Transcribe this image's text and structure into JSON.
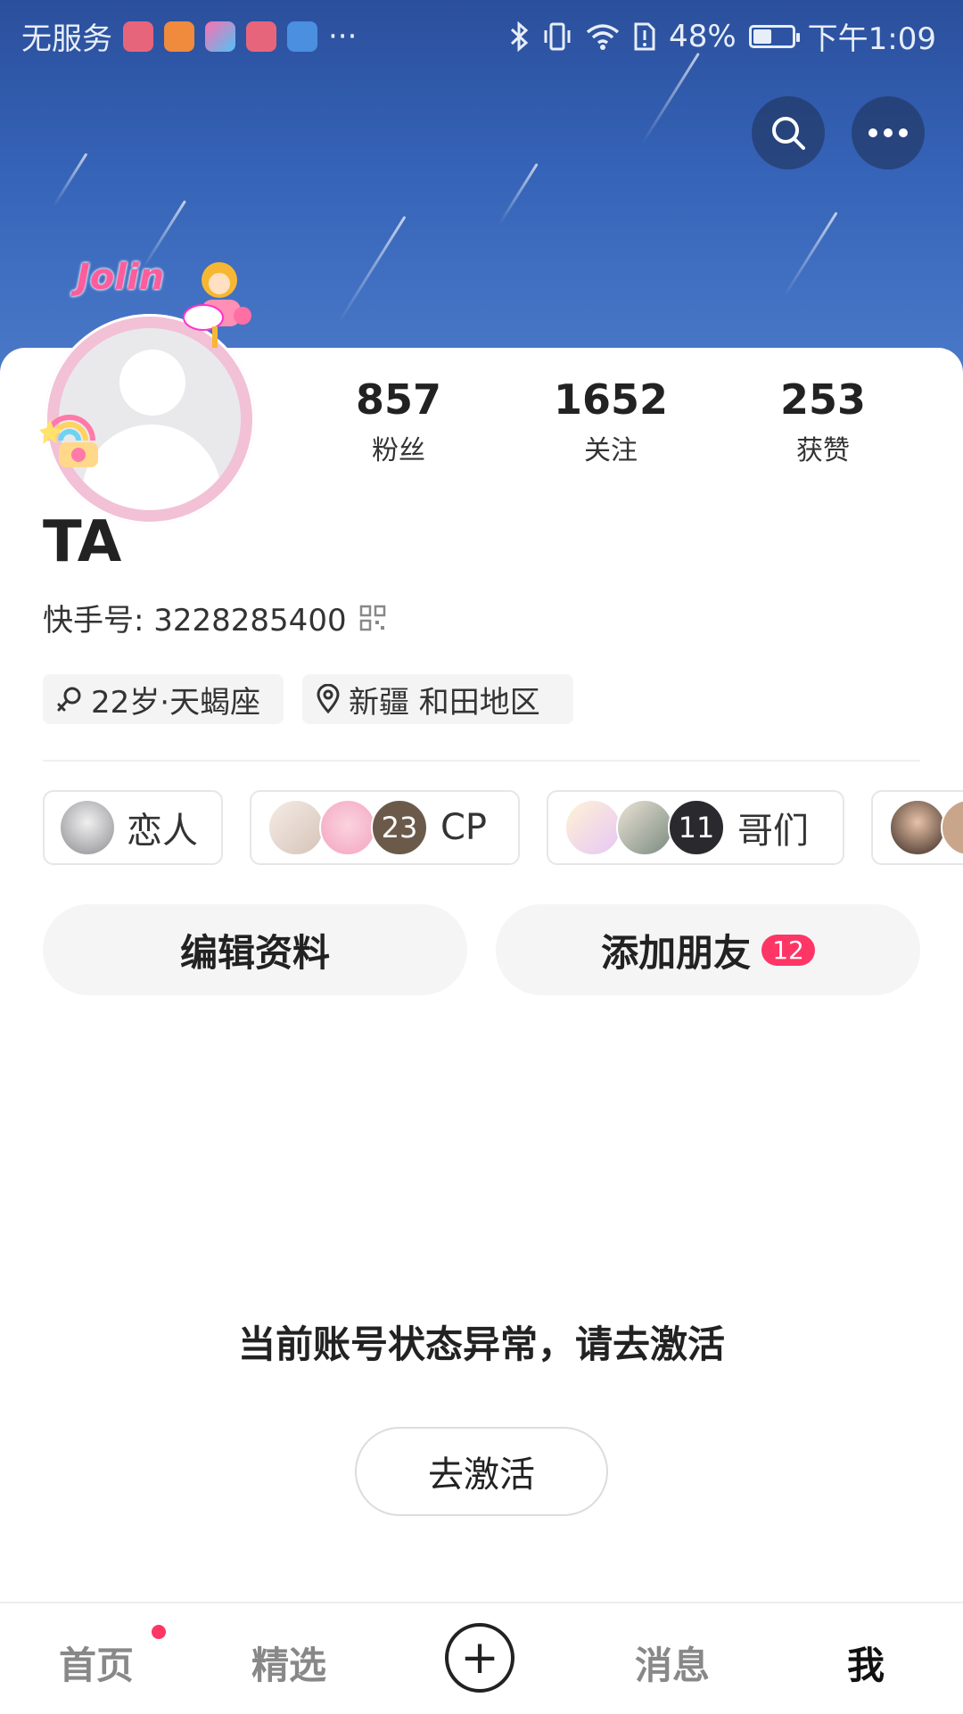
{
  "status_bar": {
    "carrier": "无服务",
    "more": "···",
    "battery": "48%",
    "battery_level": 0.48,
    "time": "下午1:09"
  },
  "header": {
    "search_icon": "search-icon",
    "more_icon": "more-icon",
    "avatar_decoration_text": "Jolin"
  },
  "stats": [
    {
      "value": "857",
      "label": "粉丝"
    },
    {
      "value": "1652",
      "label": "关注"
    },
    {
      "value": "253",
      "label": "获赞"
    }
  ],
  "profile": {
    "nickname": "TA",
    "account_id": "快手号: 3228285400",
    "tags": [
      {
        "icon": "gender-female-icon",
        "text": "22岁·天蝎座"
      },
      {
        "icon": "location-pin-icon",
        "text": "新疆 和田地区"
      }
    ]
  },
  "relations": [
    {
      "label": "恋人",
      "count": ""
    },
    {
      "label": "CP",
      "count": "23"
    },
    {
      "label": "哥们",
      "count": "11"
    }
  ],
  "actions": {
    "edit_profile": "编辑资料",
    "add_friends": "添加朋友",
    "add_friends_badge": "12"
  },
  "notice": {
    "message": "当前账号状态异常，请去激活",
    "activate": "去激活"
  },
  "nav": {
    "home": "首页",
    "featured": "精选",
    "plus": "+",
    "messages": "消息",
    "me": "我"
  },
  "colors": {
    "accent": "#fe3666",
    "header_top": "#2b4f9c",
    "header_bottom": "#4b79c9"
  }
}
